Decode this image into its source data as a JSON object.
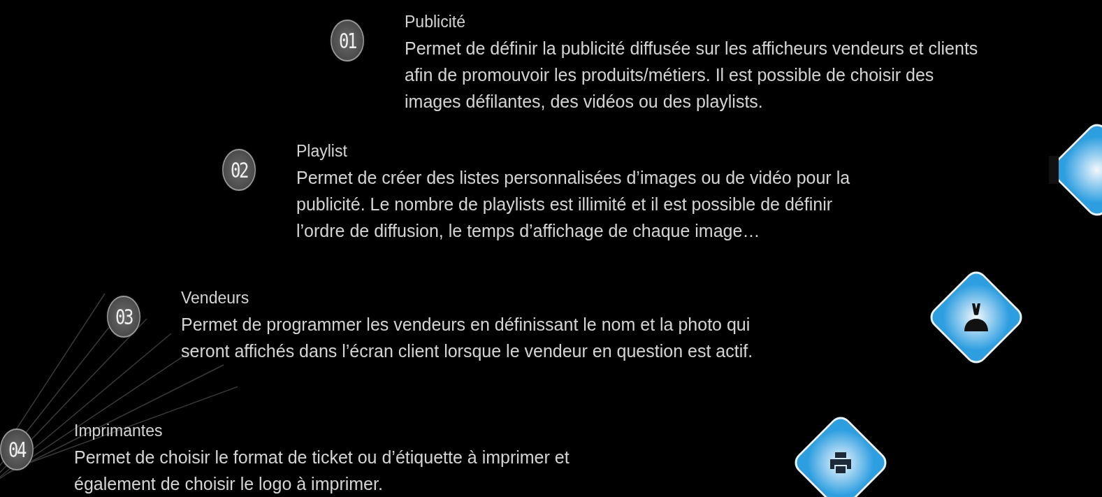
{
  "features": [
    {
      "number": "01",
      "title": "Publicité",
      "description": [
        "Permet de définir la publicité diffusée sur les afficheurs vendeurs et clients",
        "afin de promouvoir les produits/métiers. Il est possible de choisir des",
        "images défilantes, des vidéos ou des playlists."
      ]
    },
    {
      "number": "02",
      "title": "Playlist",
      "description": [
        "Permet de créer des listes personnalisées d’images ou de vidéo pour la",
        "publicité. Le nombre de playlists est illimité et il est possible de définir",
        "l’ordre de diffusion, le temps d’affichage de chaque image…"
      ]
    },
    {
      "number": "03",
      "title": "Vendeurs",
      "description": [
        "Permet de programmer les vendeurs en définissant le nom et la photo qui",
        "seront affichés dans l’écran client lorsque le vendeur en question est actif."
      ]
    },
    {
      "number": "04",
      "title": "Imprimantes",
      "description": [
        "Permet de choisir le format de ticket ou d’étiquette à imprimer et",
        "également de choisir le logo à imprimer."
      ]
    }
  ]
}
